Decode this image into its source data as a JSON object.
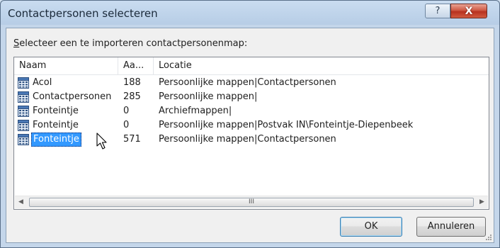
{
  "window": {
    "title": "Contactpersonen selecteren",
    "help_label": "?",
    "close_label": "X"
  },
  "prompt": {
    "mnemonic": "S",
    "rest": "electeer een te importeren contactpersonenmap:"
  },
  "list": {
    "columns": [
      "Naam",
      "Aa...",
      "Locatie"
    ],
    "rows": [
      {
        "name": "Acol",
        "count": "188",
        "location": "Persoonlijke mappen|Contactpersonen",
        "selected": false
      },
      {
        "name": "Contactpersonen",
        "count": "285",
        "location": "Persoonlijke mappen|",
        "selected": false
      },
      {
        "name": "Fonteintje",
        "count": "0",
        "location": "Archiefmappen|",
        "selected": false
      },
      {
        "name": "Fonteintje",
        "count": "0",
        "location": "Persoonlijke mappen|Postvak IN\\Fonteintje-Diepenbeek",
        "selected": false
      },
      {
        "name": "Fonteintje",
        "count": "571",
        "location": "Persoonlijke mappen|Contactpersonen",
        "selected": true
      }
    ],
    "row_icon": "contacts-folder-icon",
    "selection_color": "#3399ff"
  },
  "scrollbar": {
    "left_arrow": "◀",
    "right_arrow": "▶",
    "thumb_grip": "III"
  },
  "buttons": {
    "ok": "OK",
    "cancel": "Annuleren"
  },
  "colors": {
    "close_button": "#c7412c",
    "frame": "#b7cde6"
  }
}
